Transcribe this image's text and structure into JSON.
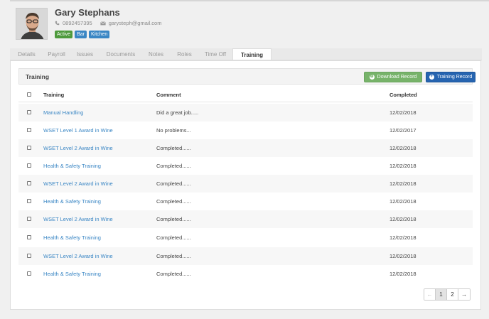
{
  "profile": {
    "name": "Gary Stephans",
    "phone": "0892457395",
    "email": "garysteph@gmail.com",
    "tags": [
      {
        "label": "Active",
        "color": "#4e9a3c"
      },
      {
        "label": "Bar",
        "color": "#3a86c4"
      },
      {
        "label": "Kitchen",
        "color": "#3a86c4"
      }
    ]
  },
  "tabs": [
    "Details",
    "Payroll",
    "Issues",
    "Documents",
    "Notes",
    "Roles",
    "Time Off",
    "Training"
  ],
  "active_tab": "Training",
  "panel": {
    "title": "Training",
    "download_button": "Download Record",
    "training_button": "Training Record"
  },
  "table": {
    "columns": [
      "Training",
      "Comment",
      "Completed"
    ],
    "rows": [
      {
        "training": "Manual Handling",
        "comment": "Did a great job.....",
        "completed": "12/02/2018"
      },
      {
        "training": "WSET Level 1 Award in Wine",
        "comment": "No problems...",
        "completed": "12/02/2017"
      },
      {
        "training": "WSET Level 2 Award in Wine",
        "comment": "Completed......",
        "completed": "12/02/2018"
      },
      {
        "training": "Health & Safety Training",
        "comment": "Completed......",
        "completed": "12/02/2018"
      },
      {
        "training": "WSET Level 2 Award in Wine",
        "comment": "Completed......",
        "completed": "12/02/2018"
      },
      {
        "training": "Health & Safety Training",
        "comment": "Completed......",
        "completed": "12/02/2018"
      },
      {
        "training": "WSET Level 2 Award in Wine",
        "comment": "Completed......",
        "completed": "12/02/2018"
      },
      {
        "training": "Health & Safety Training",
        "comment": "Completed......",
        "completed": "12/02/2018"
      },
      {
        "training": "WSET Level 2 Award in Wine",
        "comment": "Completed......",
        "completed": "12/02/2018"
      },
      {
        "training": "Health & Safety Training",
        "comment": "Completed......",
        "completed": "12/02/2018"
      }
    ]
  },
  "pagination": {
    "prev_icon": "arrow-left-icon",
    "pages": [
      "1",
      "2"
    ],
    "current": "1",
    "next_icon": "arrow-right-icon"
  }
}
